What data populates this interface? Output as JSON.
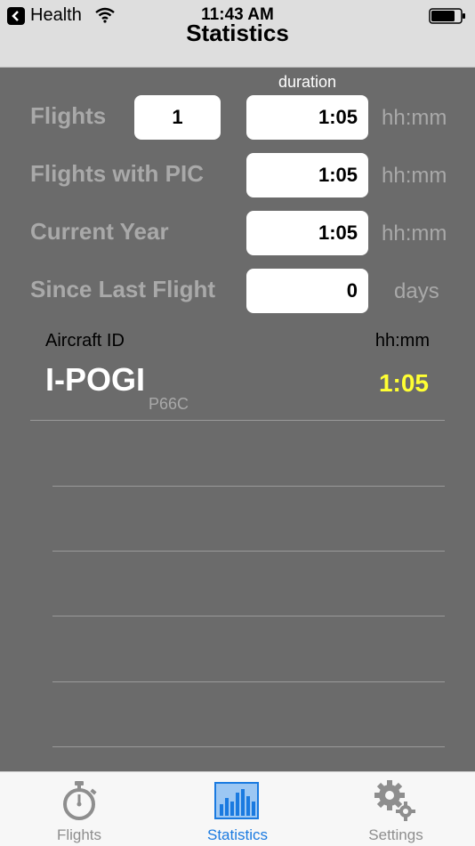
{
  "status_bar": {
    "back_app": "Health",
    "time": "11:43 AM"
  },
  "nav": {
    "title": "Statistics"
  },
  "stats": {
    "duration_header": "duration",
    "rows": [
      {
        "label": "Flights",
        "count": "1",
        "duration": "1:05",
        "unit": "hh:mm"
      },
      {
        "label": "Flights with PIC",
        "duration": "1:05",
        "unit": "hh:mm"
      },
      {
        "label": "Current Year",
        "duration": "1:05",
        "unit": "hh:mm"
      },
      {
        "label": "Since Last Flight",
        "duration": "0",
        "unit": "days"
      }
    ]
  },
  "aircraft_list": {
    "header_left": "Aircraft ID",
    "header_right": "hh:mm",
    "items": [
      {
        "id": "I-POGI",
        "type": "P66C",
        "duration": "1:05"
      }
    ]
  },
  "tabs": [
    {
      "label": "Flights",
      "icon": "stopwatch-icon",
      "active": false
    },
    {
      "label": "Statistics",
      "icon": "bar-chart-icon",
      "active": true
    },
    {
      "label": "Settings",
      "icon": "gears-icon",
      "active": false
    }
  ],
  "colors": {
    "background": "#6b6b6b",
    "accent": "#1a7ae0",
    "highlight_duration": "#ffff33"
  }
}
